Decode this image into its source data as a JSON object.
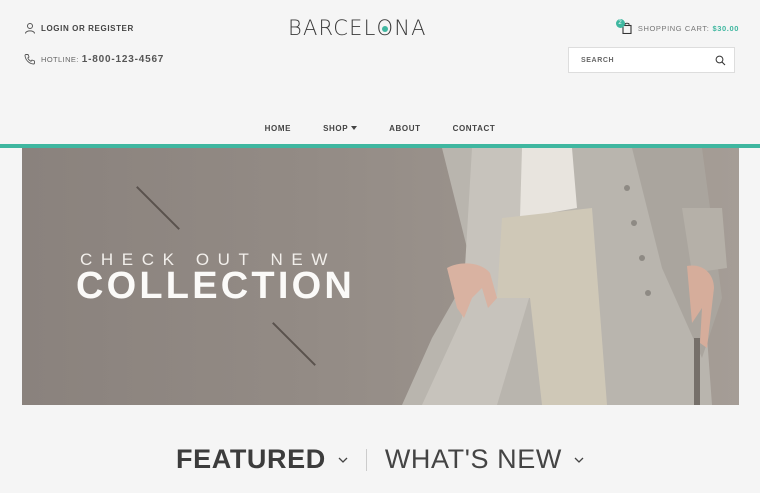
{
  "header": {
    "login_label": "LOGIN OR REGISTER",
    "hotline_label": "HOTLINE:",
    "hotline_number": "1-800-123-4567",
    "logo_before": "BARCEL",
    "logo_o": "O",
    "logo_after": "NA",
    "cart_label": "SHOPPING CART:",
    "cart_amount": "$30.00",
    "cart_count": "2",
    "search_placeholder": "SEARCH"
  },
  "nav": {
    "items": [
      {
        "label": "HOME"
      },
      {
        "label": "SHOP"
      },
      {
        "label": "ABOUT"
      },
      {
        "label": "CONTACT"
      }
    ]
  },
  "banner": {
    "kicker": "CHECK OUT NEW",
    "headline": "COLLECTION"
  },
  "tabs": {
    "featured": "FEATURED",
    "whats_new": "WHAT'S NEW"
  },
  "colors": {
    "accent": "#3fb7a0",
    "background": "#f5f5f5",
    "banner_bg": "#938b85"
  },
  "icons": [
    "user-icon",
    "phone-icon",
    "cart-icon",
    "search-icon",
    "caret-down-icon",
    "chevron-down-icon"
  ]
}
